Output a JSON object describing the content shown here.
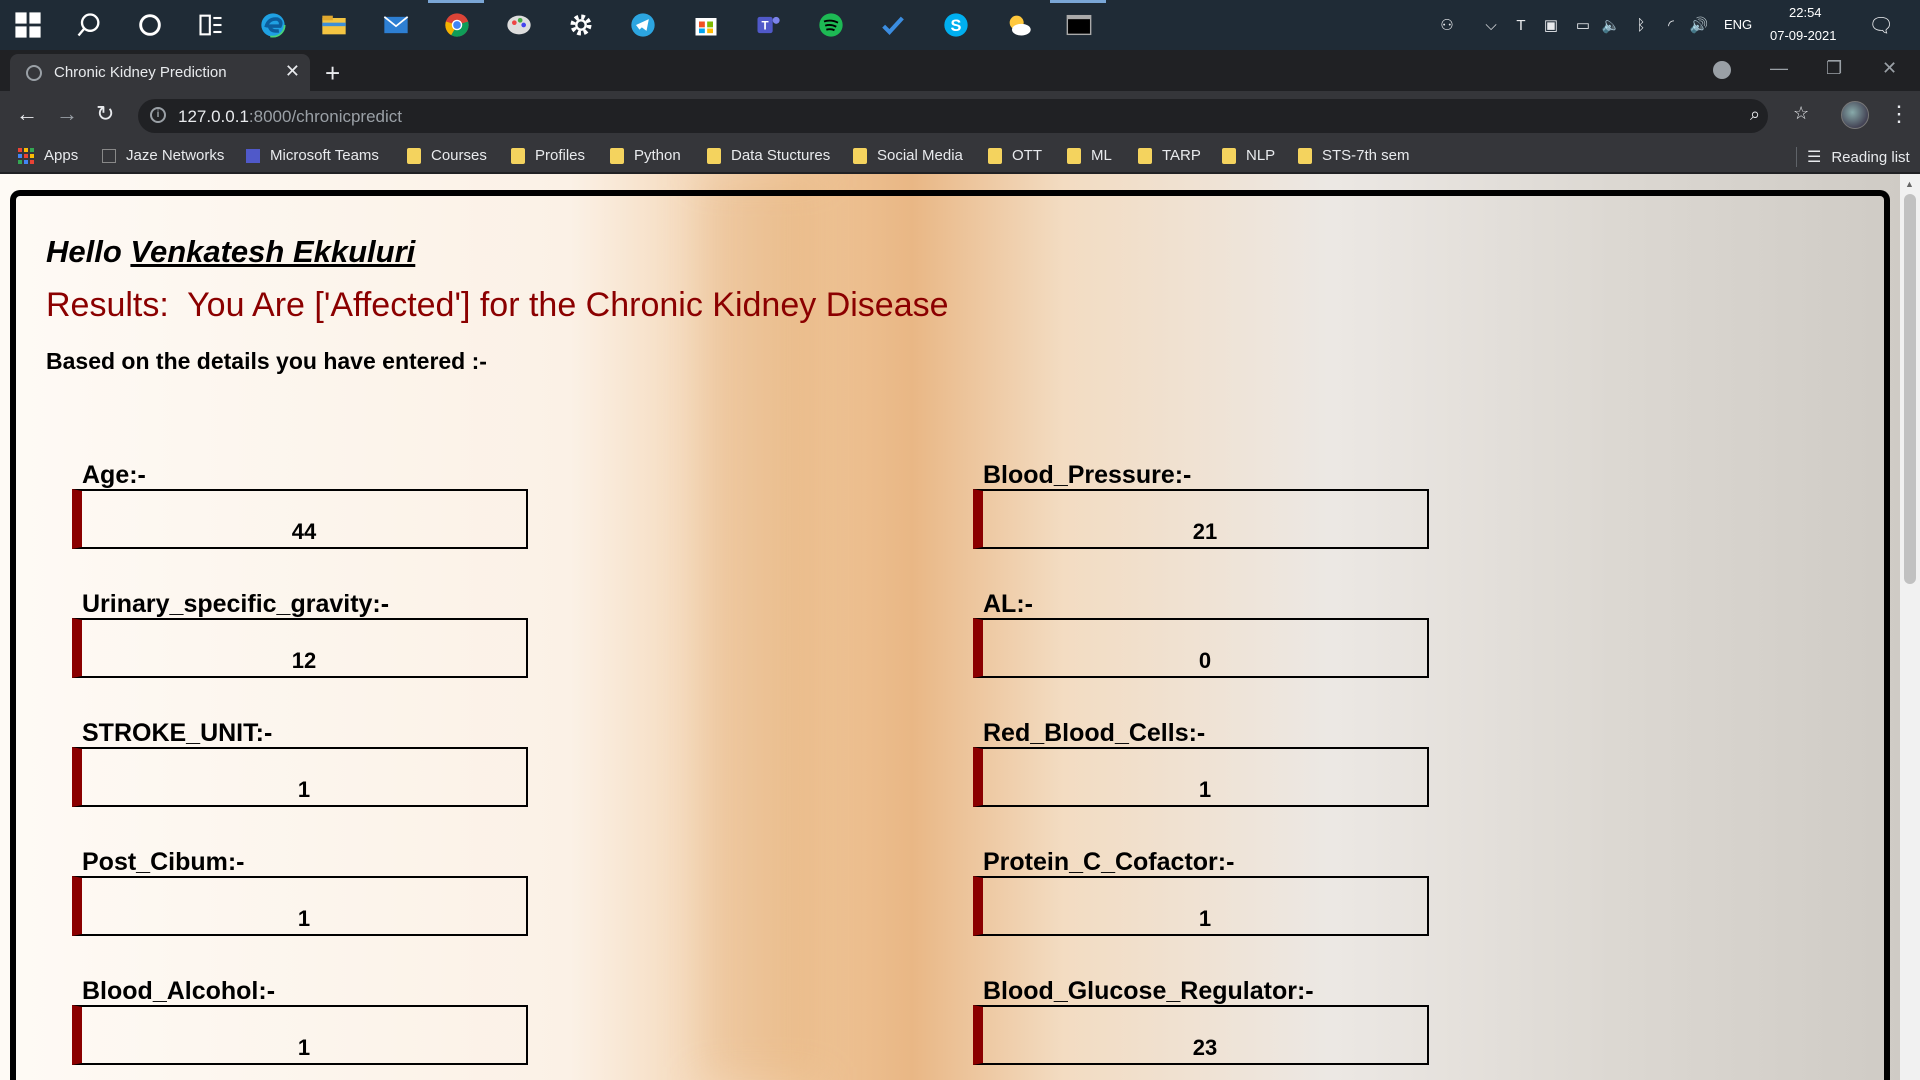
{
  "taskbar": {
    "icons": [
      "windows-icon",
      "search-icon",
      "cortana-icon",
      "task-view-icon",
      "edge-icon",
      "file-explorer-icon",
      "mail-icon",
      "chrome-icon",
      "paint-icon",
      "settings-icon",
      "telegram-icon",
      "store-icon",
      "teams-icon",
      "spotify-icon",
      "todo-icon",
      "skype-icon",
      "weather-icon",
      "terminal-icon"
    ],
    "language": "ENG",
    "time": "22:54",
    "date": "07-09-2021"
  },
  "browser": {
    "tab_title": "Chronic Kidney Prediction",
    "url_host": "127.0.0.1",
    "url_path": ":8000/chronicpredict"
  },
  "bookmarks": {
    "apps": "Apps",
    "items": [
      "Jaze Networks",
      "Microsoft Teams",
      "Courses",
      "Profiles",
      "Python",
      "Data Stuctures",
      "Social Media",
      "OTT",
      "ML",
      "TARP",
      "NLP",
      "STS-7th sem"
    ],
    "reading_list": "Reading list"
  },
  "page": {
    "hello": "Hello",
    "user_name": "Venkatesh Ekkuluri",
    "result": "Results:  You Are ['Affected'] for the Chronic Kidney Disease",
    "based_on": "Based on the details you have entered :-",
    "left_fields": [
      {
        "label": "Age:-",
        "value": "44"
      },
      {
        "label": "Urinary_specific_gravity:-",
        "value": "12"
      },
      {
        "label": "STROKE_UNIT:-",
        "value": "1"
      },
      {
        "label": "Post_Cibum:-",
        "value": "1"
      },
      {
        "label": "Blood_Alcohol:-",
        "value": "1"
      }
    ],
    "right_fields": [
      {
        "label": "Blood_Pressure:-",
        "value": "21"
      },
      {
        "label": "AL:-",
        "value": "0"
      },
      {
        "label": "Red_Blood_Cells:-",
        "value": "1"
      },
      {
        "label": "Protein_C_Cofactor:-",
        "value": "1"
      },
      {
        "label": "Blood_Glucose_Regulator:-",
        "value": "23"
      }
    ]
  }
}
